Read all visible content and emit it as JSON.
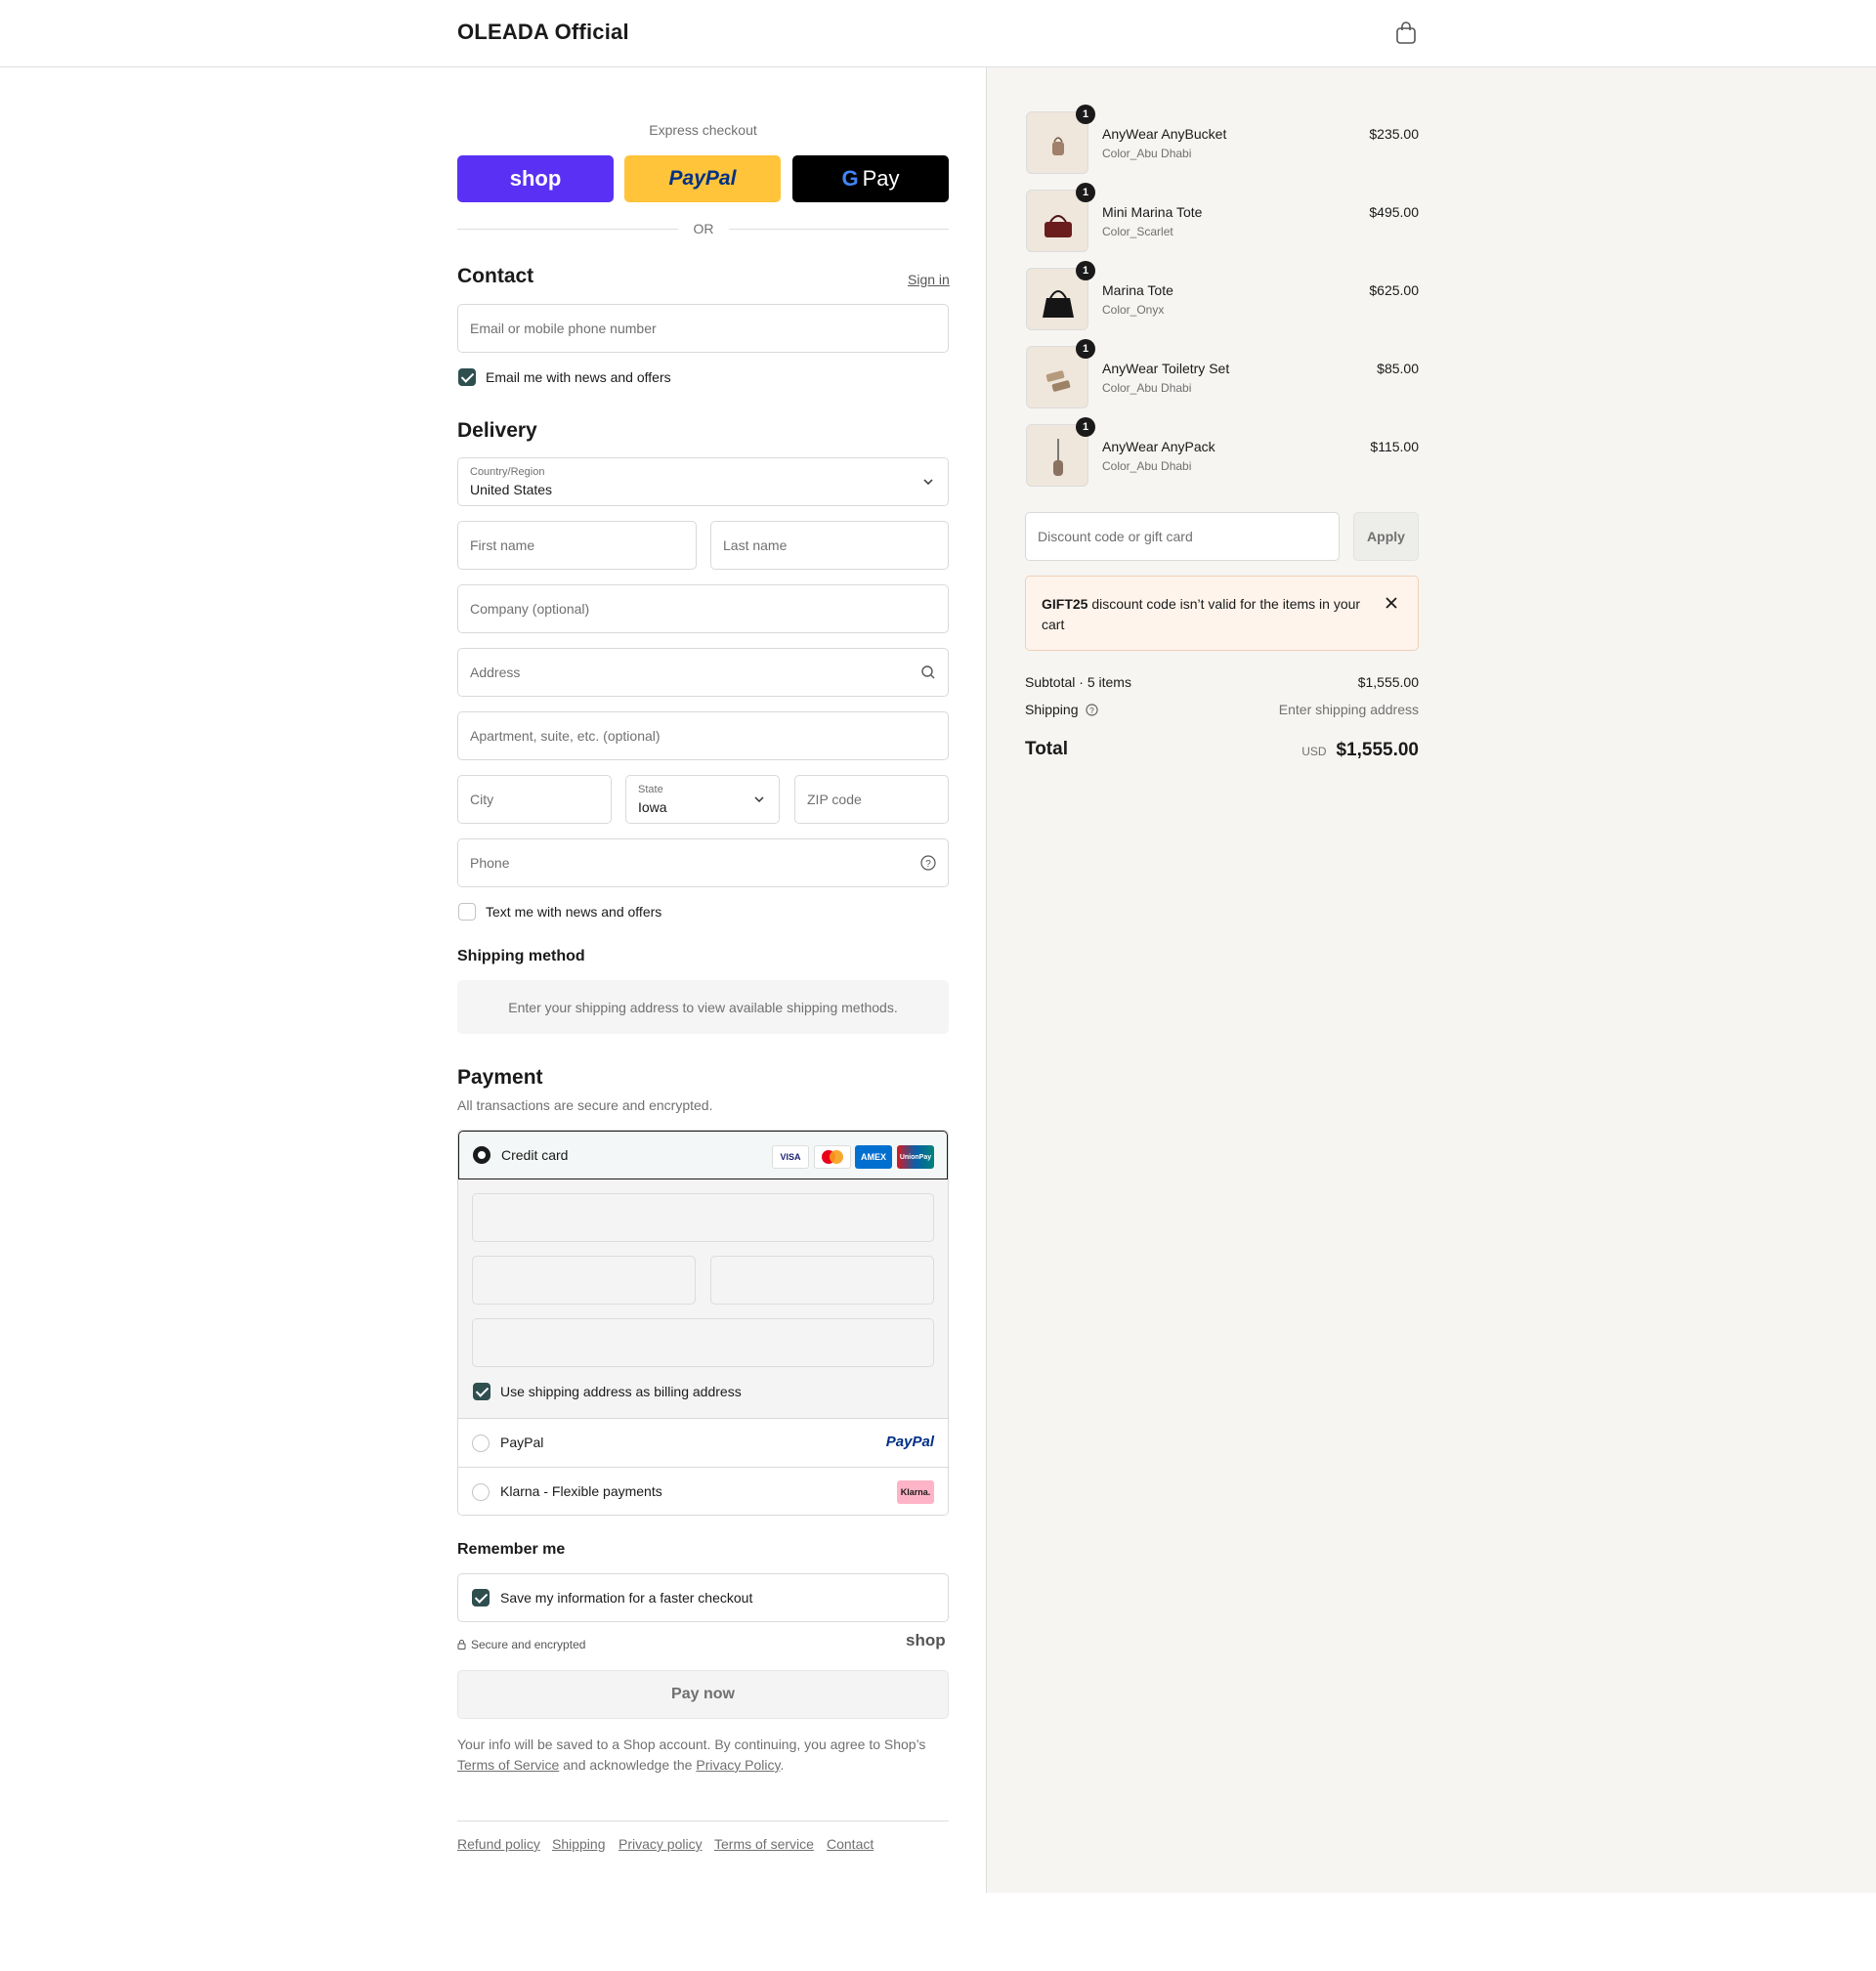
{
  "header": {
    "brand": "OLEADA Official",
    "cart_icon": "bag-icon"
  },
  "express": {
    "label": "Express checkout",
    "shop_label": "shop",
    "paypal_label": "PayPal",
    "gpay_label": "Pay",
    "or_label": "OR"
  },
  "contact": {
    "title": "Contact",
    "sign_in": "Sign in",
    "email_placeholder": "Email or mobile phone number",
    "news_label": "Email me with news and offers",
    "news_checked": true
  },
  "delivery": {
    "title": "Delivery",
    "country_label": "Country/Region",
    "country_value": "United States",
    "first_name_placeholder": "First name",
    "last_name_placeholder": "Last name",
    "company_placeholder": "Company (optional)",
    "address_placeholder": "Address",
    "apartment_placeholder": "Apartment, suite, etc. (optional)",
    "city_placeholder": "City",
    "state_label": "State",
    "state_value": "Iowa",
    "zip_placeholder": "ZIP code",
    "phone_placeholder": "Phone",
    "text_label": "Text me with news and offers",
    "text_checked": false
  },
  "shipping_method": {
    "title": "Shipping method",
    "info": "Enter your shipping address to view available shipping methods."
  },
  "payment": {
    "title": "Payment",
    "subtitle": "All transactions are secure and encrypted.",
    "credit_card_label": "Credit card",
    "card_logos": [
      "VISA",
      "Mastercard",
      "AMEX",
      "UnionPay"
    ],
    "billing_label": "Use shipping address as billing address",
    "billing_checked": true,
    "paypal_label": "PayPal",
    "paypal_logo": "PayPal",
    "klarna_label": "Klarna - Flexible payments",
    "klarna_logo": "Klarna."
  },
  "remember": {
    "title": "Remember me",
    "save_label": "Save my information for a faster checkout",
    "save_checked": true,
    "secure_label": "Secure and encrypted",
    "shop_logo": "shop"
  },
  "pay_now_label": "Pay now",
  "legal": {
    "text_1": "Your info will be saved to a Shop account. By continuing, you agree to Shop’s",
    "terms_link": "Terms of Service",
    "text_2": "and acknowledge the",
    "privacy_link": "Privacy Policy",
    "text_3": "."
  },
  "footer_links": [
    "Refund policy",
    "Shipping",
    "Privacy policy",
    "Terms of service",
    "Contact"
  ],
  "summary": {
    "items": [
      {
        "name": "AnyWear AnyBucket",
        "variant": "Color_Abu Dhabi",
        "price": "$235.00",
        "qty": "1"
      },
      {
        "name": "Mini Marina Tote",
        "variant": "Color_Scarlet",
        "price": "$495.00",
        "qty": "1"
      },
      {
        "name": "Marina Tote",
        "variant": "Color_Onyx",
        "price": "$625.00",
        "qty": "1"
      },
      {
        "name": "AnyWear Toiletry Set",
        "variant": "Color_Abu Dhabi",
        "price": "$85.00",
        "qty": "1"
      },
      {
        "name": "AnyWear AnyPack",
        "variant": "Color_Abu Dhabi",
        "price": "$115.00",
        "qty": "1"
      }
    ],
    "discount_placeholder": "Discount code or gift card",
    "apply_label": "Apply",
    "alert_code": "GIFT25",
    "alert_text": "discount code isn’t valid for the items in your cart",
    "subtotal_label": "Subtotal · 5 items",
    "subtotal_value": "$1,555.00",
    "shipping_label": "Shipping",
    "shipping_value": "Enter shipping address",
    "total_label": "Total",
    "currency": "USD",
    "total_value": "$1,555.00"
  }
}
